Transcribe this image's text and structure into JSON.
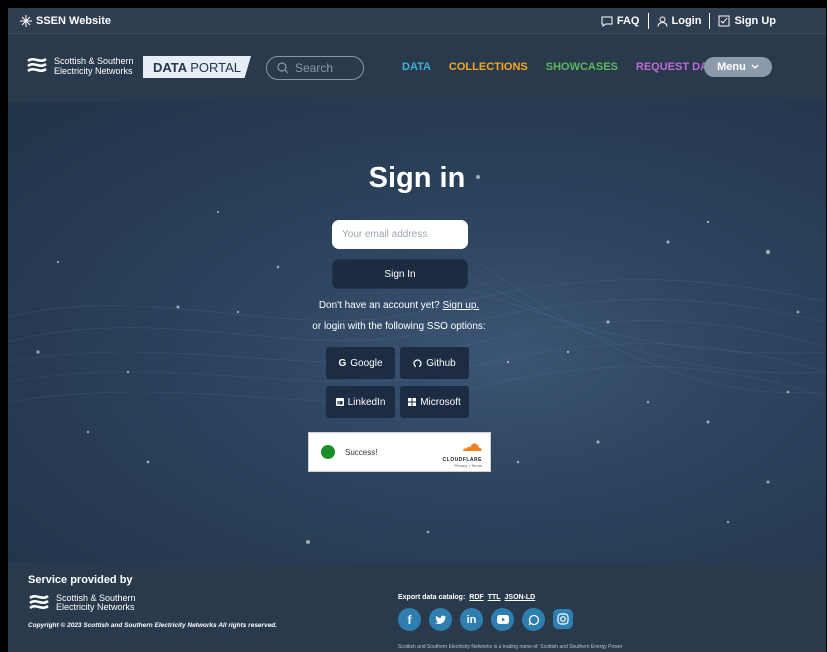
{
  "topbar": {
    "site_label": "SSEN Website",
    "faq_label": "FAQ",
    "login_label": "Login",
    "signup_label": "Sign Up"
  },
  "brand": {
    "logo_line1": "Scottish & Southern",
    "logo_line2": "Electricity Networks",
    "portal_bold": "DATA",
    "portal_light": "PORTAL"
  },
  "search": {
    "placeholder": "Search"
  },
  "nav": {
    "data": "DATA",
    "collections": "COLLECTIONS",
    "showcases": "SHOWCASES",
    "request": "REQUEST DATA",
    "menu": "Menu"
  },
  "colors": {
    "data": "#3fb1d6",
    "collections": "#f5a623",
    "showcases": "#5cb85c",
    "request": "#c06ad8",
    "accent_green": "#1b8e2c"
  },
  "signin": {
    "title": "Sign in",
    "email_placeholder": "Your email address",
    "button": "Sign In",
    "account_prompt": "Don't have an account yet?",
    "signup_link": "Sign up.",
    "sso_prompt": "or login with the following SSO options:"
  },
  "sso": {
    "google": "Google",
    "github": "Github",
    "linkedin": "LinkedIn",
    "microsoft": "Microsoft"
  },
  "captcha": {
    "status": "Success!",
    "provider": "CLOUDFLARE",
    "links": "Privacy • Terms"
  },
  "footer": {
    "service": "Service provided by",
    "logo_line1": "Scottish & Southern",
    "logo_line2": "Electricity Networks",
    "copyright": "Copyright © 2023 Scottish and Southern Electricity Networks All rights reserved.",
    "export_label": "Export data catalog:",
    "rdf": "RDF",
    "ttl": "TTL",
    "jsonld": "JSON-LD",
    "bottom_text": "Scottish and Southern Electricity Networks is a trading name of: Scottish and Southern Energy Power"
  },
  "social_icons": [
    "facebook-icon",
    "twitter-icon",
    "linkedin-icon",
    "youtube-icon",
    "whatsapp-icon",
    "instagram-icon"
  ]
}
